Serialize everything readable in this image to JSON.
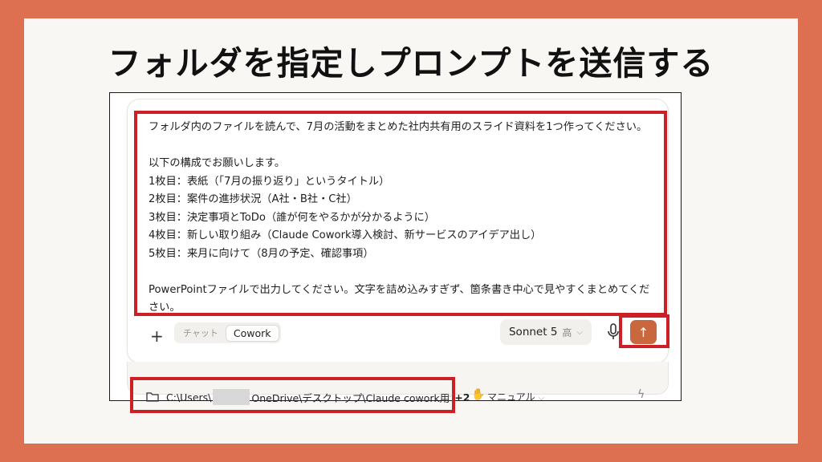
{
  "slide": {
    "title": "フォルダを指定しプロンプトを送信する"
  },
  "prompt": {
    "lines": [
      "フォルダ内のファイルを読んで、7月の活動をまとめた社内共有用のスライド資料を1つ作ってください。",
      "",
      "以下の構成でお願いします。",
      "1枚目：表紙（「7月の振り返り」というタイトル）",
      "2枚目：案件の進捗状況（A社・B社・C社）",
      "3枚目：決定事項とToDo（誰が何をやるかが分かるように）",
      "4枚目：新しい取り組み（Claude Cowork導入検討、新サービスのアイデア出し）",
      "5枚目：来月に向けて（8月の予定、確認事項）",
      "",
      "PowerPointファイルで出力してください。文字を詰め込みすぎず、箇条書き中心で見やすくまとめてください。"
    ]
  },
  "toolbar": {
    "plus": "+",
    "mode_chat": "チャット",
    "mode_cowork": "Cowork",
    "model": "Sonnet 5",
    "effort": "高",
    "send": "↑"
  },
  "footer": {
    "path_before": "C:\\Users\\",
    "path_after": "OneDrive\\デスクトップ\\Claude cowork用",
    "extra_count": "+2",
    "permission_mode": "マニュアル"
  },
  "colors": {
    "background": "#dc7051",
    "highlight": "#cc1f26",
    "send_button": "#c9673e"
  },
  "icons": [
    "plus-icon",
    "mic-icon",
    "arrow-up-icon",
    "folder-icon",
    "hand-icon",
    "bolt-icon",
    "chevron-down-icon"
  ]
}
